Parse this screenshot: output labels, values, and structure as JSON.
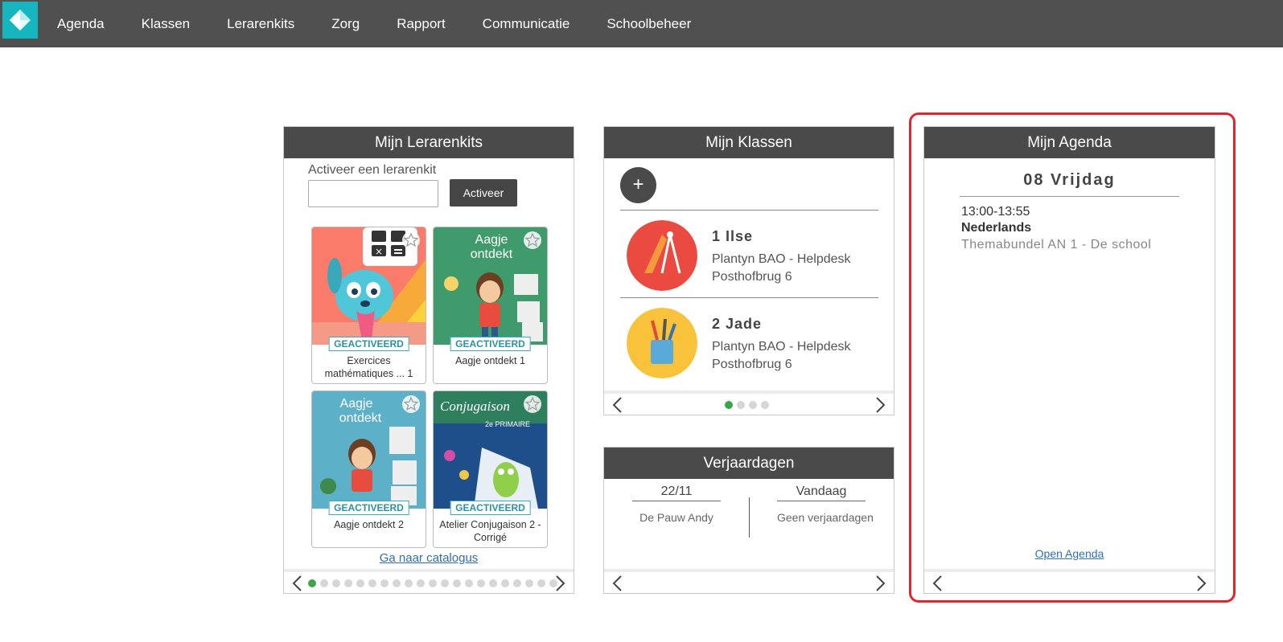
{
  "nav": {
    "logo_icon": "diamond-logo-icon",
    "items": [
      "Agenda",
      "Klassen",
      "Lerarenkits",
      "Zorg",
      "Rapport",
      "Communicatie",
      "Schoolbeheer"
    ]
  },
  "kits": {
    "title": "Mijn Lerarenkits",
    "activate_label": "Activeer een lerarenkit",
    "activate_button": "Activeer",
    "activate_value": "",
    "badge": "GEACTIVEERD",
    "items": [
      {
        "title": "Exercices mathématiques ... 1"
      },
      {
        "title": "Aagje ontdekt 1"
      },
      {
        "title": "Aagje ontdekt 2"
      },
      {
        "title": "Atelier Conjugaison 2 - Corrigé"
      }
    ],
    "catalog_link": "Ga naar catalogus",
    "page_count": 21,
    "active_page": 1
  },
  "klassen": {
    "title": "Mijn Klassen",
    "add_icon": "plus-icon",
    "items": [
      {
        "name": "1 Ilse",
        "school": "Plantyn BAO - Helpdesk",
        "address": "Posthofbrug 6"
      },
      {
        "name": "2 Jade",
        "school": "Plantyn BAO - Helpdesk",
        "address": "Posthofbrug 6"
      }
    ],
    "page_count": 4,
    "active_page": 1
  },
  "verjaardagen": {
    "title": "Verjaardagen",
    "left_head": "22/11",
    "left_value": "De Pauw Andy",
    "right_head": "Vandaag",
    "right_value": "Geen verjaardagen"
  },
  "agenda": {
    "title": "Mijn Agenda",
    "day": "08 Vrijdag",
    "time": "13:00-13:55",
    "subject": "Nederlands",
    "description": "Themabundel AN 1 - De school",
    "open_link": "Open Agenda"
  },
  "colors": {
    "topbar": "#505050",
    "logo": "#15b6bf",
    "panel_header": "#4a4a4a",
    "active_dot": "#3aa64a",
    "highlight": "#e0262b",
    "link": "#2f6fb0"
  }
}
